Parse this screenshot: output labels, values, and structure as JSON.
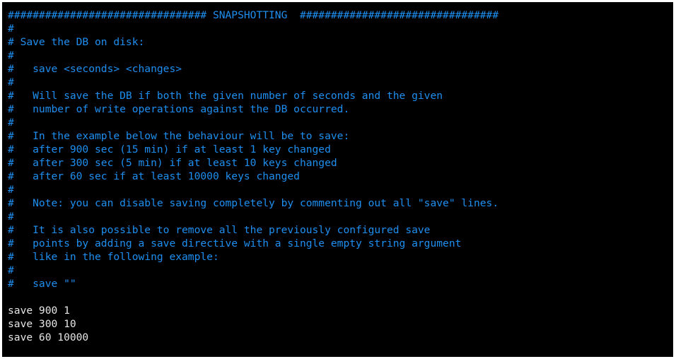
{
  "colors": {
    "background": "#000000",
    "comment": "#1e8ff0",
    "code": "#e6e6e6"
  },
  "lines": [
    "################################ SNAPSHOTTING  ################################",
    "#",
    "# Save the DB on disk:",
    "#",
    "#   save <seconds> <changes>",
    "#",
    "#   Will save the DB if both the given number of seconds and the given",
    "#   number of write operations against the DB occurred.",
    "#",
    "#   In the example below the behaviour will be to save:",
    "#   after 900 sec (15 min) if at least 1 key changed",
    "#   after 300 sec (5 min) if at least 10 keys changed",
    "#   after 60 sec if at least 10000 keys changed",
    "#",
    "#   Note: you can disable saving completely by commenting out all \"save\" lines.",
    "#",
    "#   It is also possible to remove all the previously configured save",
    "#   points by adding a save directive with a single empty string argument",
    "#   like in the following example:",
    "#",
    "#   save \"\"",
    "",
    "save 900 1",
    "save 300 10",
    "save 60 10000"
  ]
}
